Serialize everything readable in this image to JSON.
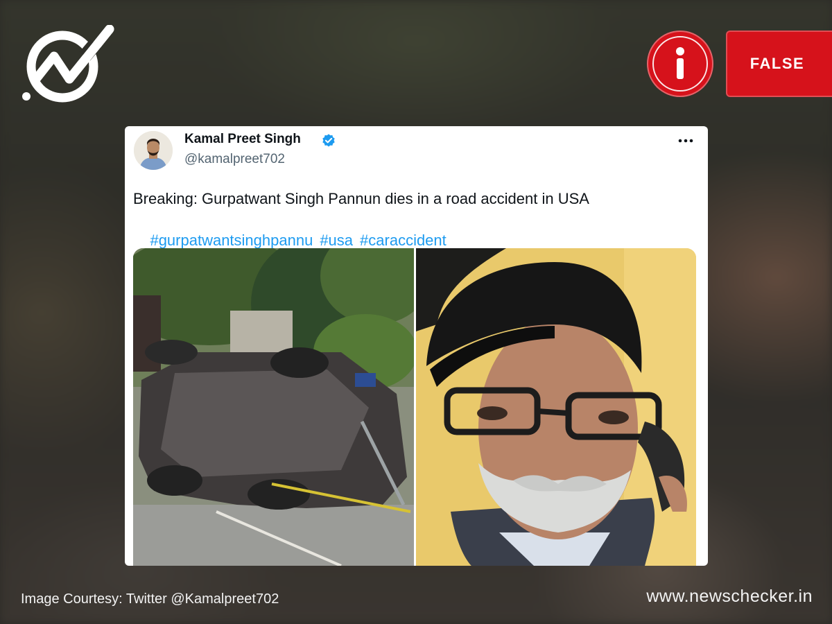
{
  "brand": {
    "logo_icon": "newschecker-check-logo-icon",
    "site_url": "www.newschecker.in"
  },
  "verdict": {
    "icon": "info-icon",
    "label": "FALSE",
    "color": "#d6121b"
  },
  "tweet": {
    "display_name": "Kamal Preet Singh",
    "verified_icon": "verified-badge-icon",
    "handle": "@kamalpreet702",
    "more_icon": "more-options-icon",
    "text": "Breaking: Gurpatwant Singh Pannun dies in a road accident in USA",
    "hashtags": [
      "#gurpatwantsinghpannu",
      "#usa",
      "#caraccident"
    ],
    "hashtag_color": "#1d9bf0",
    "media": [
      {
        "name": "overturned-car-photo"
      },
      {
        "name": "man-in-black-turban-photo"
      }
    ]
  },
  "footer": {
    "courtesy": "Image Courtesy: Twitter @Kamalpreet702"
  }
}
